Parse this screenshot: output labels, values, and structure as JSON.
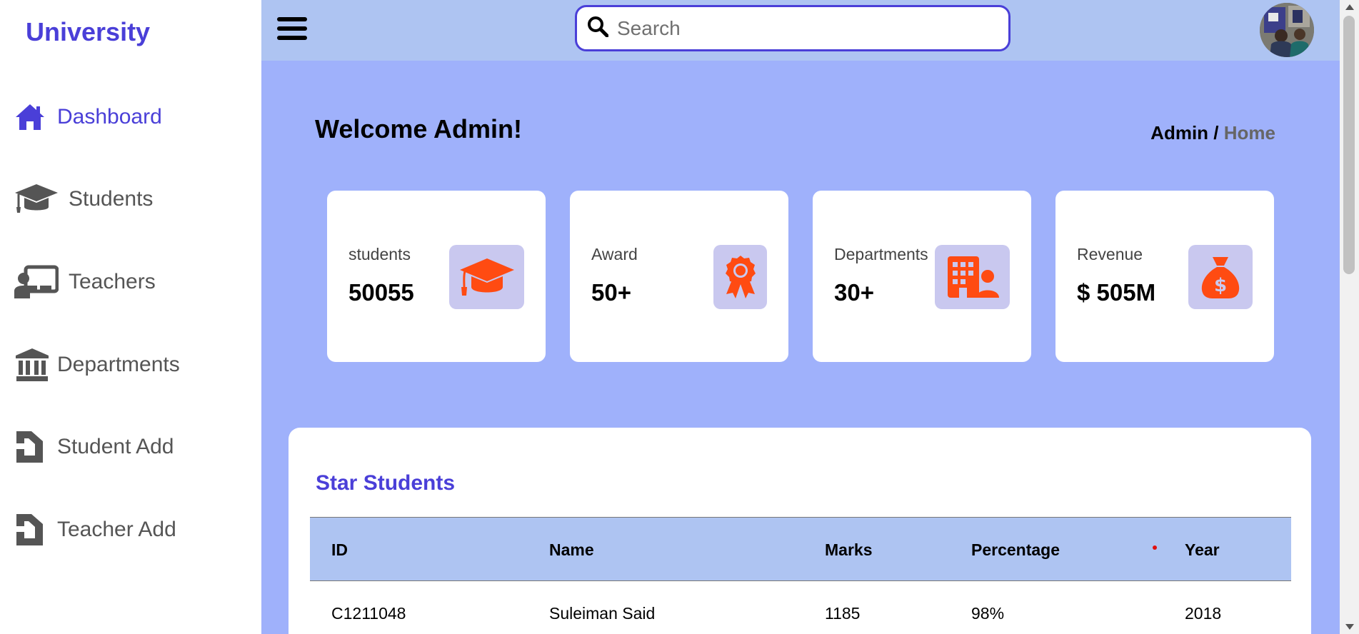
{
  "sidebar": {
    "brand": "University",
    "items": [
      {
        "label": "Dashboard",
        "icon": "home-icon"
      },
      {
        "label": "Students",
        "icon": "graduation-cap-icon"
      },
      {
        "label": "Teachers",
        "icon": "chalkboard-teacher-icon"
      },
      {
        "label": "Departments",
        "icon": "building-columns-icon"
      },
      {
        "label": "Student Add",
        "icon": "document-icon"
      },
      {
        "label": "Teacher Add",
        "icon": "document-icon"
      }
    ]
  },
  "header": {
    "search_placeholder": "Search"
  },
  "main": {
    "welcome": "Welcome Admin!",
    "breadcrumb": {
      "first": "Admin /",
      "current": "Home"
    },
    "stats": [
      {
        "label": "students",
        "value": "50055",
        "icon": "graduation-cap-icon"
      },
      {
        "label": "Award",
        "value": "50+",
        "icon": "award-ribbon-icon"
      },
      {
        "label": "Departments",
        "value": "30+",
        "icon": "building-user-icon"
      },
      {
        "label": "Revenue",
        "value": "$ 505M",
        "icon": "money-bag-icon"
      }
    ],
    "star_students": {
      "title": "Star Students",
      "columns": [
        "ID",
        "Name",
        "Marks",
        "Percentage",
        "Year"
      ],
      "rows": [
        [
          "C1211048",
          "Suleiman Said",
          "1185",
          "98%",
          "2018"
        ]
      ]
    }
  },
  "colors": {
    "accent": "#4a3fd8",
    "topbar": "#aec4f2",
    "main_bg": "#9fb1fb",
    "icon_orange": "#ff4b12",
    "icon_tile": "#c9c8ef"
  }
}
